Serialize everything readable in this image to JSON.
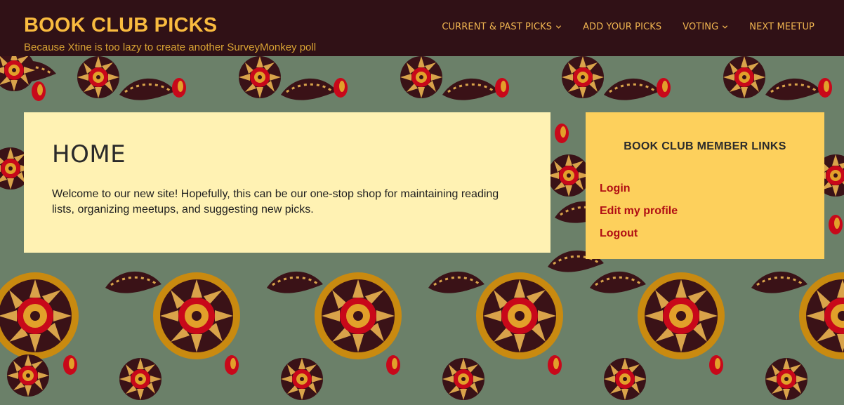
{
  "header": {
    "site_title": "BOOK CLUB PICKS",
    "tagline": "Because Xtine is too lazy to create another SurveyMonkey poll",
    "nav": [
      {
        "label": "CURRENT & PAST PICKS",
        "has_dropdown": true,
        "icon": "chevron-down-icon"
      },
      {
        "label": "ADD YOUR PICKS",
        "has_dropdown": false
      },
      {
        "label": "VOTING",
        "has_dropdown": true,
        "icon": "chevron-down-icon"
      },
      {
        "label": "NEXT MEETUP",
        "has_dropdown": false
      }
    ]
  },
  "main": {
    "title": "HOME",
    "body": "Welcome to our new site! Hopefully, this can be our one-stop shop for maintaining reading lists, organizing meetups, and suggesting new picks."
  },
  "sidebar": {
    "widget_title": "BOOK CLUB MEMBER LINKS",
    "links": [
      {
        "label": "Login"
      },
      {
        "label": "Edit my profile"
      },
      {
        "label": "Logout"
      }
    ]
  },
  "colors": {
    "header_bg": "#301116",
    "title": "#f9bb3f",
    "nav_text": "#f0b550",
    "content_bg": "#fff2b3",
    "sidebar_bg": "#fdd05c",
    "link": "#b00e14",
    "pattern_bg": "#6b8069"
  }
}
